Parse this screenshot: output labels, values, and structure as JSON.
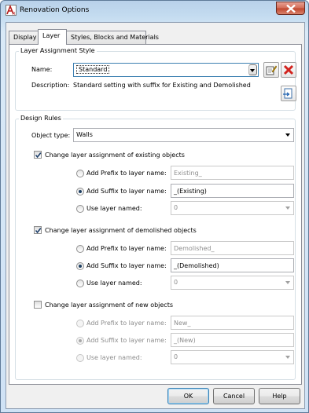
{
  "window": {
    "title": "Renovation Options"
  },
  "tabs": [
    {
      "label": "Display"
    },
    {
      "label": "Layer"
    },
    {
      "label": "Styles, Blocks and Materials"
    }
  ],
  "layer_assignment_style": {
    "legend": "Layer Assignment Style",
    "name_label": "Name:",
    "name_value": "Standard",
    "description_label": "Description:",
    "description_value": "Standard setting with suffix for Existing and Demolished"
  },
  "design_rules": {
    "legend": "Design Rules",
    "object_type_label": "Object type:",
    "object_type_value": "Walls",
    "existing": {
      "checkbox_label": "Change layer assignment of existing objects",
      "checked": true,
      "prefix_label": "Add Prefix to layer name:",
      "prefix_value": "Existing_",
      "suffix_label": "Add Suffix to layer name:",
      "suffix_value": "_(Existing)",
      "use_layer_label": "Use layer named:",
      "use_layer_value": "0",
      "selected": "suffix"
    },
    "demolished": {
      "checkbox_label": "Change layer assignment of demolished objects",
      "checked": true,
      "prefix_label": "Add Prefix to layer name:",
      "prefix_value": "Demolished_",
      "suffix_label": "Add Suffix to layer name:",
      "suffix_value": "_(Demolished)",
      "use_layer_label": "Use layer named:",
      "use_layer_value": "0",
      "selected": "suffix"
    },
    "new": {
      "checkbox_label": "Change layer assignment of new objects",
      "checked": false,
      "prefix_label": "Add Prefix to layer name:",
      "prefix_value": "New_",
      "suffix_label": "Add Suffix to layer name:",
      "suffix_value": "_(New)",
      "use_layer_label": "Use layer named:",
      "use_layer_value": "0",
      "selected": "suffix"
    }
  },
  "buttons": {
    "ok": "OK",
    "cancel": "Cancel",
    "help": "Help"
  },
  "colors": {
    "accent": "#3c7fb1",
    "delete_red": "#d2231e",
    "title_gradient_top": "#b9d1ea"
  },
  "icons": [
    "autocad-app-icon",
    "close-icon",
    "edit-style-icon",
    "delete-style-icon",
    "import-style-icon"
  ]
}
